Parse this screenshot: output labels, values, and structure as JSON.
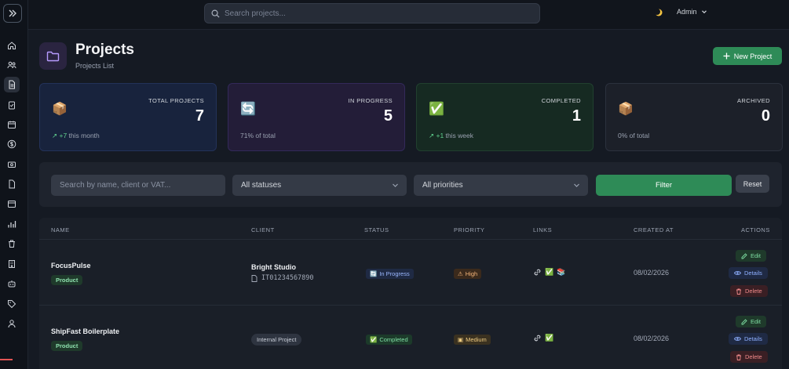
{
  "topbar": {
    "search_placeholder": "Search projects...",
    "user_label": "Admin"
  },
  "header": {
    "title": "Projects",
    "subtitle": "Projects List",
    "new_button": "New Project"
  },
  "stats": [
    {
      "label": "TOTAL PROJECTS",
      "value": "7",
      "trend": "↗ +7",
      "sub": " this month",
      "emoji": "📦"
    },
    {
      "label": "IN PROGRESS",
      "value": "5",
      "sub": "71% of total",
      "emoji": "🔄"
    },
    {
      "label": "COMPLETED",
      "value": "1",
      "trend": "↗ +1",
      "sub": " this week",
      "emoji": "✅"
    },
    {
      "label": "ARCHIVED",
      "value": "0",
      "sub": "0% of total",
      "emoji": "📦"
    }
  ],
  "filters": {
    "search_placeholder": "Search by name, client or VAT...",
    "status_value": "All statuses",
    "priority_value": "All priorities",
    "filter_button": "Filter",
    "reset_button": "Reset"
  },
  "table": {
    "headers": {
      "name": "NAME",
      "client": "CLIENT",
      "status": "STATUS",
      "priority": "PRIORITY",
      "links": "LINKS",
      "created_at": "CREATED AT",
      "actions": "ACTIONS"
    },
    "rows": [
      {
        "name": "FocusPulse",
        "type": "Product",
        "client": "Bright Studio",
        "vat": "IT01234567890",
        "status": "In Progress",
        "priority": "High",
        "created_at": "08/02/2026"
      },
      {
        "name": "ShipFast Boilerplate",
        "type": "Product",
        "client": "Internal Project",
        "status": "Completed",
        "priority": "Medium",
        "created_at": "08/02/2026"
      }
    ],
    "actions": {
      "edit": "Edit",
      "details": "Details",
      "delete": "Delete"
    }
  }
}
